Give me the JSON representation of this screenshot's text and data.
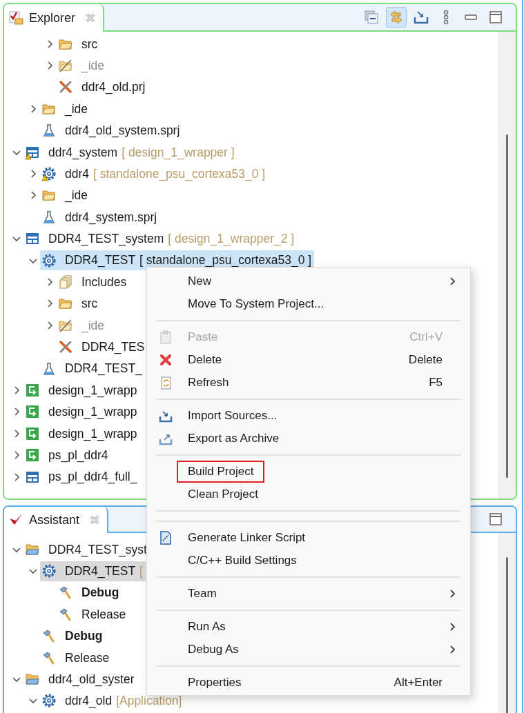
{
  "explorer": {
    "focused": true,
    "tab": {
      "title": "Explorer"
    },
    "toolbar": [
      {
        "kind": "collapse_all",
        "selected": false
      },
      {
        "kind": "link",
        "selected": true
      },
      {
        "kind": "import",
        "selected": false
      },
      {
        "kind": "view_menu",
        "selected": false
      },
      {
        "kind": "minimize",
        "selected": false
      },
      {
        "kind": "maximize",
        "selected": false
      }
    ],
    "tree": [
      {
        "children": [
          {
            "children": [
              {
                "label": "src",
                "kind": "folder",
                "expanded": false,
                "selected": false,
                "excluded": false,
                "warning": false
              },
              {
                "label": "_ide",
                "kind": "folder_excluded",
                "expanded": false,
                "selected": false,
                "excluded": true,
                "warning": false
              },
              {
                "label": "ddr4_old.prj",
                "kind": "project_file",
                "selected": false,
                "excluded": false,
                "warning": false
              }
            ]
          },
          {
            "label": "_ide",
            "kind": "folder",
            "expanded": false,
            "selected": false,
            "excluded": false,
            "warning": false
          },
          {
            "label": "ddr4_old_system.sprj",
            "kind": "system_file",
            "selected": false,
            "excluded": false,
            "warning": false
          }
        ]
      },
      {
        "label": "ddr4_system",
        "detail": "[ design_1_wrapper ]",
        "kind": "system_project",
        "expanded": true,
        "selected": false,
        "excluded": false,
        "warning": true,
        "children": [
          {
            "label": "ddr4",
            "detail": "[ standalone_psu_cortexa53_0 ]",
            "kind": "application",
            "expanded": false,
            "selected": false,
            "excluded": false,
            "warning": true
          },
          {
            "label": "_ide",
            "kind": "folder",
            "expanded": false,
            "selected": false,
            "excluded": false,
            "warning": false
          },
          {
            "label": "ddr4_system.sprj",
            "kind": "system_file",
            "selected": false,
            "excluded": false,
            "warning": false
          }
        ]
      },
      {
        "label": "DDR4_TEST_system",
        "detail": "[ design_1_wrapper_2 ]",
        "kind": "system_project",
        "expanded": true,
        "selected": false,
        "excluded": false,
        "warning": false,
        "children": [
          {
            "label": "DDR4_TEST",
            "detail": "[ standalone_psu_cortexa53_0 ]",
            "kind": "application",
            "expanded": true,
            "selected": true,
            "excluded": false,
            "warning": false,
            "children": [
              {
                "label": "Includes",
                "kind": "includes",
                "expanded": false,
                "selected": false,
                "excluded": false,
                "warning": false
              },
              {
                "label": "src",
                "kind": "folder",
                "expanded": false,
                "selected": false,
                "excluded": false,
                "warning": false
              },
              {
                "label": "_ide",
                "kind": "folder_excluded",
                "expanded": false,
                "selected": false,
                "excluded": true,
                "warning": false
              },
              {
                "label": "DDR4_TES",
                "kind": "project_file",
                "selected": false,
                "excluded": false,
                "warning": false
              }
            ]
          },
          {
            "label": "DDR4_TEST_",
            "kind": "system_file",
            "selected": false,
            "excluded": false,
            "warning": false
          }
        ]
      },
      {
        "label": "design_1_wrapp",
        "kind": "platform",
        "expanded": false,
        "selected": false,
        "excluded": false,
        "warning": false
      },
      {
        "label": "design_1_wrapp",
        "kind": "platform",
        "expanded": false,
        "selected": false,
        "excluded": false,
        "warning": false
      },
      {
        "label": "design_1_wrapp",
        "kind": "platform",
        "expanded": false,
        "selected": false,
        "excluded": false,
        "warning": false
      },
      {
        "label": "ps_pl_ddr4",
        "kind": "platform",
        "expanded": false,
        "selected": false,
        "excluded": false,
        "warning": false
      },
      {
        "label": "ps_pl_ddr4_full_",
        "kind": "system_project",
        "expanded": false,
        "selected": false,
        "excluded": false,
        "warning": false
      }
    ]
  },
  "assistant": {
    "focused": false,
    "tab": {
      "title": "Assistant"
    },
    "toolbar": [
      {
        "kind": "maximize",
        "selected": false
      }
    ],
    "tree": [
      {
        "label": "DDR4_TEST_syst",
        "kind": "system_folder",
        "expanded": true,
        "selected": false,
        "active": false,
        "children": [
          {
            "label": "DDR4_TEST",
            "detail": "[",
            "kind": "application",
            "expanded": true,
            "selected": true,
            "active": false,
            "children": [
              {
                "label": "Debug",
                "kind": "build_config",
                "selected": false,
                "active": true
              },
              {
                "label": "Release",
                "kind": "build_config",
                "selected": false,
                "active": false
              }
            ]
          },
          {
            "label": "Debug",
            "kind": "build_config",
            "selected": false,
            "active": true
          },
          {
            "label": "Release",
            "kind": "build_config",
            "selected": false,
            "active": false
          }
        ]
      },
      {
        "label": "ddr4_old_syster",
        "kind": "system_folder",
        "expanded": true,
        "selected": false,
        "active": false,
        "children": [
          {
            "label": "ddr4_old",
            "detail": "[Application]",
            "kind": "application",
            "expanded": true,
            "selected": false,
            "active": false
          }
        ]
      }
    ]
  },
  "context_menu": {
    "items": [
      {
        "kind": "item",
        "label": "New",
        "submenu": true,
        "disabled": false,
        "annotated": false
      },
      {
        "kind": "item",
        "label": "Move To System Project...",
        "submenu": false,
        "disabled": false,
        "annotated": false
      },
      {
        "kind": "separator"
      },
      {
        "kind": "paste",
        "label": "Paste",
        "shortcut": "Ctrl+V",
        "submenu": false,
        "disabled": true,
        "annotated": false
      },
      {
        "kind": "delete",
        "label": "Delete",
        "shortcut": "Delete",
        "submenu": false,
        "disabled": false,
        "annotated": false
      },
      {
        "kind": "refresh",
        "label": "Refresh",
        "shortcut": "F5",
        "submenu": false,
        "disabled": false,
        "annotated": false
      },
      {
        "kind": "separator"
      },
      {
        "kind": "import",
        "label": "Import Sources...",
        "submenu": false,
        "disabled": false,
        "annotated": false
      },
      {
        "kind": "export",
        "label": "Export as Archive",
        "submenu": false,
        "disabled": false,
        "annotated": false
      },
      {
        "kind": "separator"
      },
      {
        "kind": "item",
        "label": "Build Project",
        "submenu": false,
        "disabled": false,
        "annotated": true
      },
      {
        "kind": "item",
        "label": "Clean Project",
        "submenu": false,
        "disabled": false,
        "annotated": false
      },
      {
        "kind": "separator"
      },
      {
        "kind": "separator"
      },
      {
        "kind": "linker",
        "label": "Generate Linker Script",
        "submenu": false,
        "disabled": false,
        "annotated": false
      },
      {
        "kind": "item",
        "label": "C/C++ Build Settings",
        "submenu": false,
        "disabled": false,
        "annotated": false
      },
      {
        "kind": "separator"
      },
      {
        "kind": "item",
        "label": "Team",
        "submenu": true,
        "disabled": false,
        "annotated": false
      },
      {
        "kind": "separator"
      },
      {
        "kind": "item",
        "label": "Run As",
        "submenu": true,
        "disabled": false,
        "annotated": false
      },
      {
        "kind": "item",
        "label": "Debug As",
        "submenu": true,
        "disabled": false,
        "annotated": false
      },
      {
        "kind": "separator"
      },
      {
        "kind": "item",
        "label": "Properties",
        "shortcut": "Alt+Enter",
        "submenu": false,
        "disabled": false,
        "annotated": false
      }
    ]
  }
}
